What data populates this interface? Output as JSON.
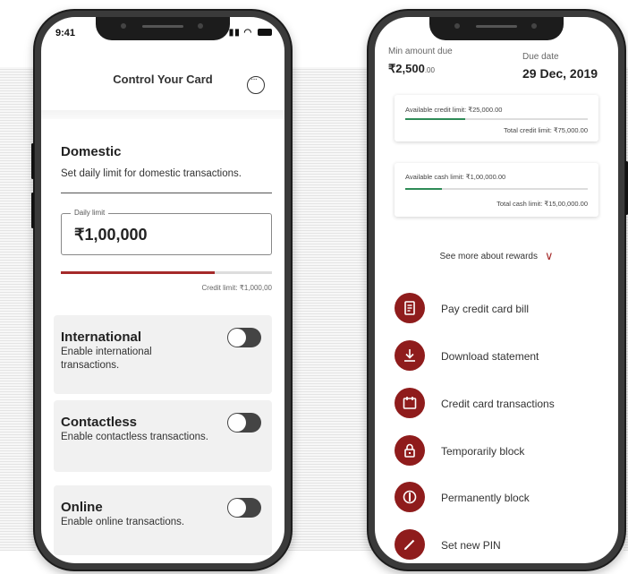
{
  "left_phone": {
    "status": {
      "time": "9:41"
    },
    "header": {
      "title": "Control Your Card"
    },
    "domestic": {
      "title": "Domestic",
      "subtitle": "Set daily limit for domestic transactions.",
      "daily_limit_label": "Daily limit",
      "daily_limit_value": "₹1,00,000",
      "credit_limit": "Credit limit: ₹1,000,00",
      "progress_fraction": 0.73
    },
    "international": {
      "title": "International",
      "subtitle": "Enable international transactions."
    },
    "contactless": {
      "title": "Contactless",
      "subtitle": "Enable contactless transactions."
    },
    "online": {
      "title": "Online",
      "subtitle": "Enable online transactions."
    }
  },
  "right_phone": {
    "min_amount_due_label": "Min amount due",
    "min_amount_due_value": "₹2,500",
    "min_amount_due_decimal": ".00",
    "due_date_label": "Due date",
    "due_date_value": "29 Dec, 2019",
    "credit_limit_card": {
      "available": "Available credit limit: ₹25,000.00",
      "total": "Total credit limit: ₹75,000.00",
      "fraction": 0.33
    },
    "cash_limit_card": {
      "available": "Available cash limit: ₹1,00,000.00",
      "total": "Total cash limit: ₹15,00,000.00",
      "fraction": 0.2
    },
    "rewards_link": "See more about rewards",
    "actions": [
      {
        "label": "Pay credit card bill",
        "icon": "bill-icon"
      },
      {
        "label": "Download statement",
        "icon": "download-icon"
      },
      {
        "label": "Credit card transactions",
        "icon": "calendar-icon"
      },
      {
        "label": "Temporarily block",
        "icon": "lock-icon"
      },
      {
        "label": "Permanently block",
        "icon": "block-icon"
      },
      {
        "label": "Set new PIN",
        "icon": "pen-icon"
      }
    ]
  },
  "colors": {
    "accent": "#a52a2a",
    "icon_bg": "#8f1c1c",
    "progress_green": "#2e8b57",
    "toggle": "#444444"
  }
}
